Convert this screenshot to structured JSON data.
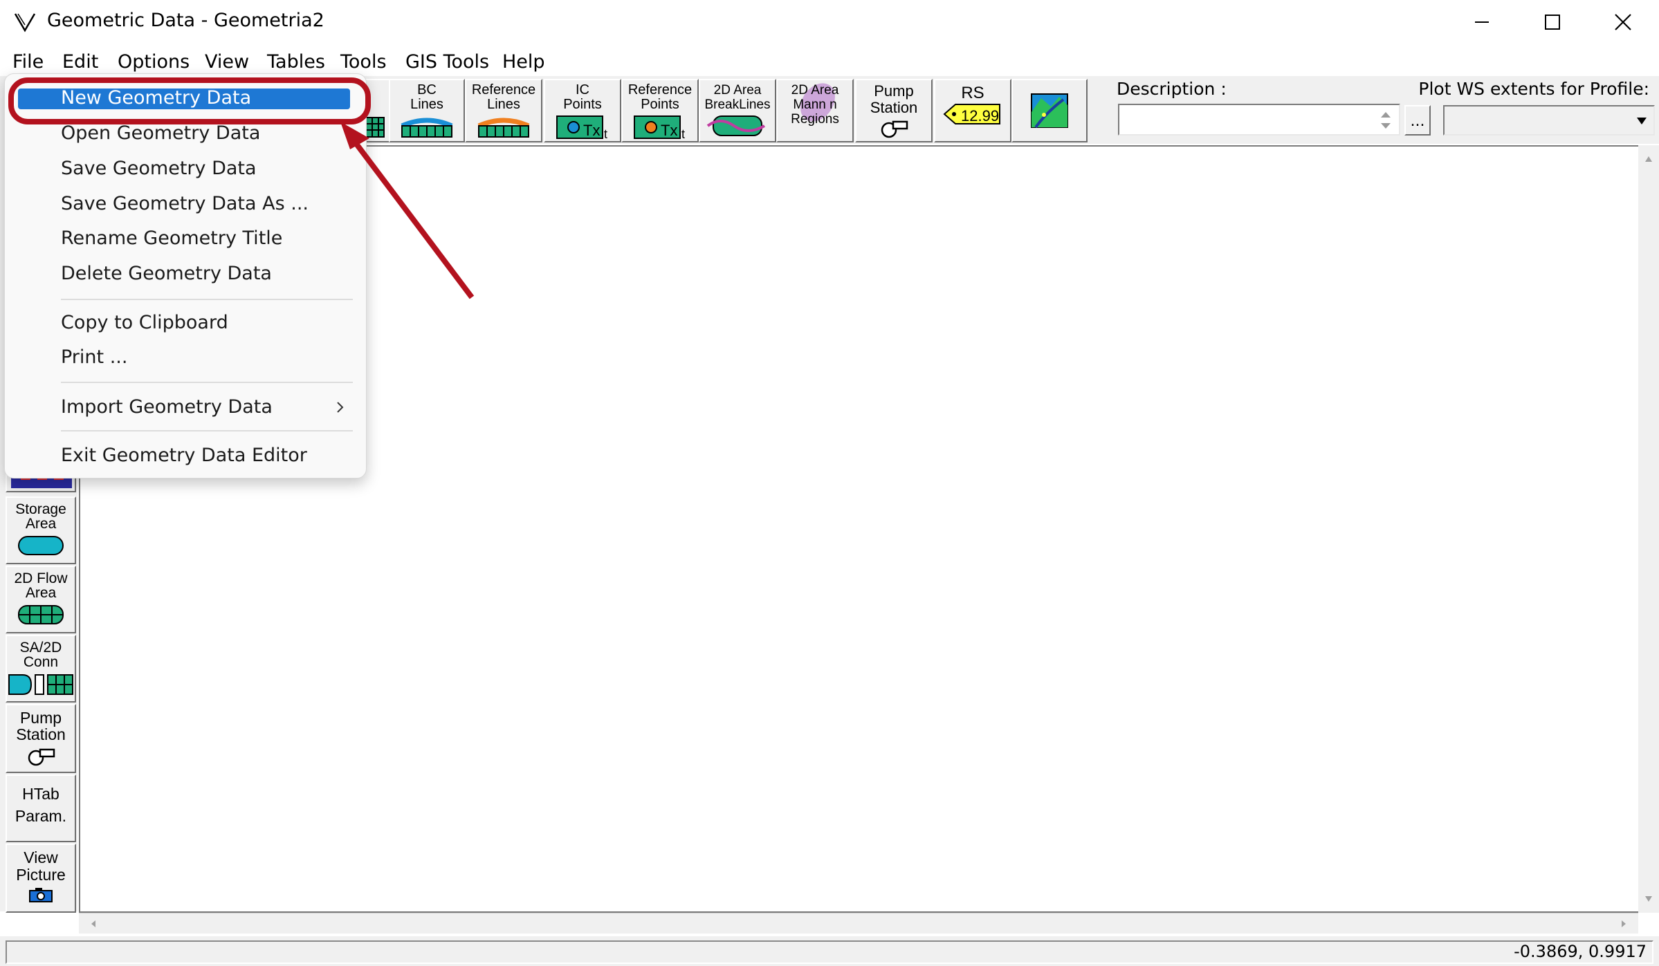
{
  "window": {
    "title": "Geometric Data - Geometria2",
    "app_icon": "hecras-icon",
    "controls": [
      "minimize-icon",
      "maximize-icon",
      "close-icon"
    ]
  },
  "menubar": {
    "items": [
      "File",
      "Edit",
      "Options",
      "View",
      "Tables",
      "Tools",
      "GIS Tools",
      "Help"
    ]
  },
  "toolbar": {
    "buttons": [
      {
        "label": "BC\nLines",
        "icon": "bc-lines-icon"
      },
      {
        "label": "Reference\nLines",
        "icon": "reference-lines-icon"
      },
      {
        "label": "IC\nPoints",
        "icon": "ic-points-icon"
      },
      {
        "label": "Reference\nPoints",
        "icon": "reference-points-icon"
      },
      {
        "label": "2D Area\nBreakLines",
        "icon": "breaklines-icon"
      },
      {
        "label": "2D Area\nMann n\nRegions",
        "icon": "mann-regions-icon"
      },
      {
        "label": "Pump\nStation",
        "icon": "pump-icon"
      },
      {
        "label": "RS",
        "icon": "rs-tag-icon",
        "tag_value": "12.99"
      },
      {
        "label": "",
        "icon": "map-icon"
      }
    ],
    "description_label": "Description :",
    "description_value": "",
    "ellipsis_label": "...",
    "plot_ws_label": "Plot WS extents for Profile:",
    "plot_ws_value": ""
  },
  "sidebar": {
    "buttons": [
      {
        "label": "Storage\nArea",
        "icon": "storage-area-icon"
      },
      {
        "label": "2D Flow\nArea",
        "icon": "2d-flow-area-icon"
      },
      {
        "label": "SA/2D\nConn",
        "icon": "sa-2d-conn-icon"
      },
      {
        "label": "Pump\nStation",
        "icon": "pump-icon"
      },
      {
        "label": "HTab\nParam.",
        "icon": ""
      },
      {
        "label": "View\nPicture",
        "icon": "camera-icon"
      }
    ]
  },
  "file_menu": {
    "items": [
      {
        "label": "New Geometry Data",
        "highlighted": true
      },
      {
        "label": "Open Geometry Data"
      },
      {
        "label": "Save Geometry Data"
      },
      {
        "label": "Save Geometry Data As ..."
      },
      {
        "label": "Rename Geometry Title"
      },
      {
        "label": "Delete Geometry Data"
      },
      {
        "label": "Copy to Clipboard"
      },
      {
        "label": "Print ..."
      },
      {
        "label": "Import Geometry Data",
        "submenu": true
      },
      {
        "label": "Exit Geometry Data Editor"
      }
    ]
  },
  "annotation": {
    "color": "#b3121e"
  },
  "status": {
    "coordinates": "-0.3869, 0.9917"
  },
  "colors": {
    "highlight": "#1e78d4",
    "annotation": "#b3121e"
  }
}
